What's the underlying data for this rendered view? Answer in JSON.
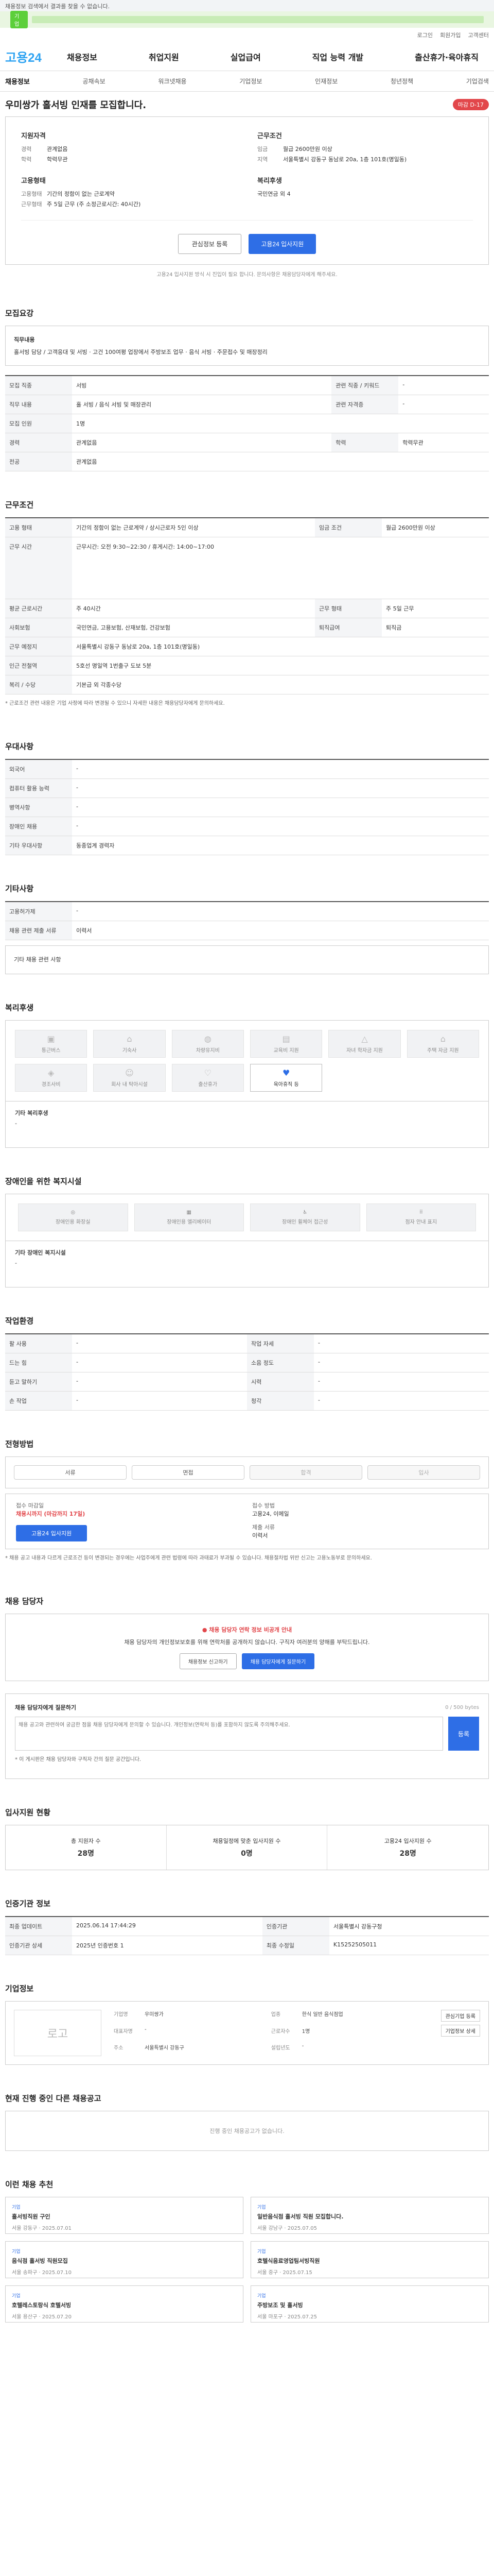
{
  "top_notice": "채용정보 검색에서 결과를 찾을 수 없습니다.",
  "banner": {
    "label": "기업"
  },
  "util": [
    "로그인",
    "회원가입",
    "고객센터"
  ],
  "logo": {
    "main": "고용",
    "num": "24"
  },
  "gnb": [
    "채용정보",
    "취업지원",
    "실업급여",
    "직업 능력 개발",
    "출산휴가·육아휴직"
  ],
  "subnav": [
    "채용정보",
    "공채속보",
    "워크넷채용",
    "기업정보",
    "인재정보",
    "청년정책",
    "기업검색"
  ],
  "job": {
    "title": "우미쌍가 홀서빙 인재를 모집합니다.",
    "badge": "마감 D-17",
    "summary": {
      "qual_title": "지원자격",
      "qual": [
        [
          "경력",
          "관계없음"
        ],
        [
          "학력",
          "학력무관"
        ]
      ],
      "cond_title": "근무조건",
      "cond": [
        [
          "임금",
          "월급 2600만원 이상"
        ],
        [
          "지역",
          "서울특별시 강동구 동남로 20a, 1층 101호(명일동)"
        ]
      ],
      "form_title": "고용형태",
      "form": [
        [
          "고용형태",
          "기간의 정함이 없는 근로계약"
        ],
        [
          "근무형태",
          "주 5일 근무 (주 소정근로시간: 40시간)"
        ]
      ],
      "welfare_title": "복리후생",
      "welfare": "국민연금 외 4",
      "btn_scrap": "관심정보 등록",
      "btn_apply": "고용24 입사지원",
      "disclaimer": "고용24 입사지원 방식 시 진입이 필요 합니다. 문의사항은 채용담당자에게 해주세요."
    }
  },
  "sections": {
    "recruit": {
      "title": "모집요강",
      "duty_title": "직무내용",
      "duty": "홀서빙 담당 / 고객응대 및 서빙 · 고건 100여평 업장에서 주방보조 업무 · 음식 서빙 · 주문접수 및 매장정리",
      "rows": [
        [
          "모집 직종",
          "서빙",
          "관련 직종 / 키워드",
          "-"
        ],
        [
          "직무 내용",
          "홀 서빙 / 음식 서빙 및 매장관리",
          "관련 자격증",
          "-"
        ],
        [
          "모집 인원",
          "1명",
          "",
          ""
        ],
        [
          "경력",
          "관계없음",
          "학력",
          "학력무관"
        ],
        [
          "전공",
          "관계없음",
          "",
          ""
        ]
      ]
    },
    "work": {
      "title": "근무조건",
      "rows": [
        [
          "고용 형태",
          "기간의 정함이 없는 근로계약 / 상시근로자 5인 이상",
          "임금 조건",
          "월급 2600만원 이상"
        ],
        [
          "근무 시간",
          "근무시간: 오전 9:30~22:30 / 휴게시간: 14:00~17:00",
          "",
          ""
        ],
        [
          "평균 근로시간",
          "주 40시간",
          "근무 형태",
          "주 5일 근무"
        ],
        [
          "사회보험",
          "국민연금, 고용보험, 산재보험, 건강보험",
          "퇴직급여",
          "퇴직금"
        ],
        [
          "근무 예정지",
          "서울특별시 강동구 동남로 20a, 1층 101호(명일동)",
          "",
          ""
        ],
        [
          "인근 전철역",
          "5호선 명일역 1번출구 도보 5분",
          "",
          ""
        ],
        [
          "복리 / 수당",
          "기본급 외 각종수당",
          "",
          ""
        ]
      ],
      "note": "* 근로조건 관련 내용은 기업 사정에 따라 변경될 수 있으니 자세한 내용은 채용담당자에게 문의하세요."
    },
    "pref": {
      "title": "우대사항",
      "rows": [
        [
          "외국어",
          "-"
        ],
        [
          "컴퓨터 활용 능력",
          "-"
        ],
        [
          "병역사항",
          "-"
        ],
        [
          "장애인 채용",
          "-"
        ],
        [
          "기타 우대사항",
          "동종업계 경력자"
        ]
      ]
    },
    "etc": {
      "title": "기타사항",
      "rows": [
        [
          "고용허가제",
          "-"
        ],
        [
          "채용 관련 제출 서류",
          "이력서"
        ]
      ],
      "extra": "기타 채용 관련 사항"
    },
    "benefit": {
      "title": "복리후생",
      "items": [
        {
          "label": "통근버스",
          "on": false
        },
        {
          "label": "기숙사",
          "on": false
        },
        {
          "label": "차량유지비",
          "on": false
        },
        {
          "label": "교육비 지원",
          "on": false
        },
        {
          "label": "자녀 학자금 지원",
          "on": false
        },
        {
          "label": "주택 자금 지원",
          "on": false
        },
        {
          "label": "경조사비",
          "on": false
        },
        {
          "label": "회사 내 탁아시설",
          "on": false
        },
        {
          "label": "출산휴가",
          "on": false
        },
        {
          "label": "육아휴직 등",
          "on": true
        }
      ],
      "note_title": "기타 복리후생",
      "note": "-"
    },
    "disabled": {
      "title": "장애인을 위한 복지시설",
      "items": [
        "장애인용 화장실",
        "장애인용 엘리베이터",
        "장애인 휠체어 접근성",
        "점자 안내 표지"
      ],
      "note_title": "기타 장애인 복지시설",
      "note": "-"
    },
    "env": {
      "title": "작업환경",
      "rows": [
        [
          "팔 사용",
          "-",
          "작업 자세",
          "-"
        ],
        [
          "드는 힘",
          "-",
          "소음 정도",
          "-"
        ],
        [
          "듣고 말하기",
          "-",
          "시력",
          "-"
        ],
        [
          "손 작업",
          "-",
          "청각",
          "-"
        ]
      ]
    },
    "process": {
      "title": "전형방법",
      "steps": [
        "서류",
        "면접",
        "합격",
        "입사"
      ],
      "apply_method_label": "접수 마감일",
      "deadline": "채용시까지 (마감까지 17일)",
      "method_label": "접수 방법",
      "method": "고용24, 이메일",
      "doc_label": "제출 서류",
      "doc": "이력서",
      "btn_apply": "고용24 입사지원",
      "bullets": "* 채용 공고 내용과 다르게 근로조건 등이 변경되는 경우에는 사업주에게 관련 법령에 따라 과태료가 부과될 수 있습니다. 채용절차법 위반 신고는 고용노동부로 문의하세요."
    },
    "contact": {
      "title": "채용 담당자",
      "warn": "채용 담당자 연락 정보 비공개 안내",
      "desc": "채용 담당자의 개인정보보호를 위해 연락처를 공개하지 않습니다. 구직자 여러분의 양해를 부탁드립니다.",
      "btn1": "채용정보 신고하기",
      "btn2": "채용 담당자에게 질문하기"
    },
    "qna": {
      "title": "채용 담당자에게 질문하기",
      "placeholder": "채용 공고와 관련하여 궁금한 점을 채용 담당자에게 문의할 수 있습니다. 개인정보(연락처 등)를 포함하지 않도록 주의해주세요.",
      "count": "0 / 500 bytes",
      "btn": "등록",
      "note": "* 이 게시판은 채용 담당자와 구직자 간의 질문 공간입니다."
    },
    "stats": {
      "title": "입사지원 현황",
      "items": [
        {
          "label": "총 지원자 수",
          "val": "28명"
        },
        {
          "label": "채용일정에 맞춘 입사지원 수",
          "val": "0명"
        },
        {
          "label": "고용24 입사지원 수",
          "val": "28명"
        }
      ]
    },
    "org": {
      "title": "인증기관 정보",
      "rows": [
        [
          "최종 업데이트",
          "2025.06.14 17:44:29",
          "인증기관",
          "서울특별시 강동구청"
        ],
        [
          "인증기관 상세",
          "2025년 인증번호 1",
          "최종 수정일",
          "K15252505011"
        ]
      ]
    },
    "company": {
      "title": "기업정보",
      "logo_alt": "로고",
      "info": [
        [
          "기업명",
          "우미쌍가",
          "업종",
          "한식 일반 음식점업"
        ],
        [
          "대표자명",
          "-",
          "근로자수",
          "1명"
        ],
        [
          "주소",
          "서울특별시 강동구",
          "설립년도",
          "-"
        ]
      ],
      "btns": [
        "관심기업 등록",
        "기업정보 상세"
      ]
    },
    "others": {
      "title": "현재 진행 중인 다른 채용공고",
      "empty": "진행 중인 채용공고가 없습니다."
    },
    "ads": {
      "title": "이런 채용 추천",
      "items": [
        {
          "co": "기업",
          "title": "홀서빙직원 구인",
          "meta": "서울 강동구 · 2025.07.01"
        },
        {
          "co": "기업",
          "title": "일반음식점 홀서빙 직원 모집합니다.",
          "meta": "서울 강남구 · 2025.07.05"
        },
        {
          "co": "기업",
          "title": "음식점 홀서빙 직원모집",
          "meta": "서울 송파구 · 2025.07.10"
        },
        {
          "co": "기업",
          "title": "호텔식음료영업팀서빙직원",
          "meta": "서울 중구 · 2025.07.15"
        },
        {
          "co": "기업",
          "title": "호텔레스토랑식 호텔서빙",
          "meta": "서울 용산구 · 2025.07.20"
        },
        {
          "co": "기업",
          "title": "주방보조 및 홀서빙",
          "meta": "서울 마포구 · 2025.07.25"
        }
      ]
    }
  }
}
